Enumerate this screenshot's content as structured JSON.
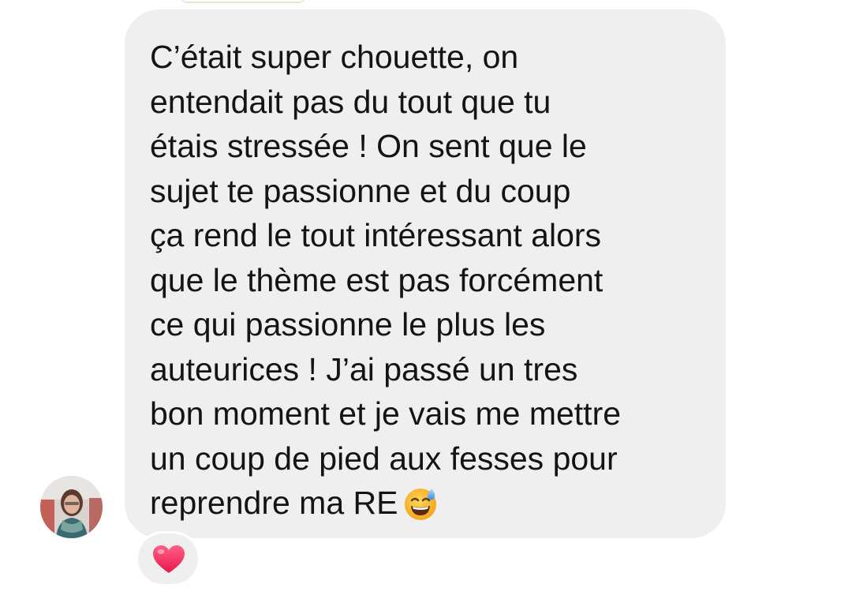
{
  "message": {
    "text": "C’était super chouette, on\nentendait pas du tout que tu\nétais stressée ! On sent que le\nsujet te passionne et du coup\nça rend le tout intéressant alors\nque le thème est pas forcément\nce qui passionne le plus les\nauteurices ! J’ai passé un tres\nbon moment et je vais me mettre\nun coup de pied aux fesses pour\nreprendre ma RE",
    "trailing_emoji": "grinning-face-with-sweat-icon"
  },
  "reaction": {
    "icon": "heart-icon",
    "color": "#f2335f"
  },
  "colors": {
    "bubble": "#efefef",
    "text": "#141414",
    "background": "#ffffff"
  }
}
